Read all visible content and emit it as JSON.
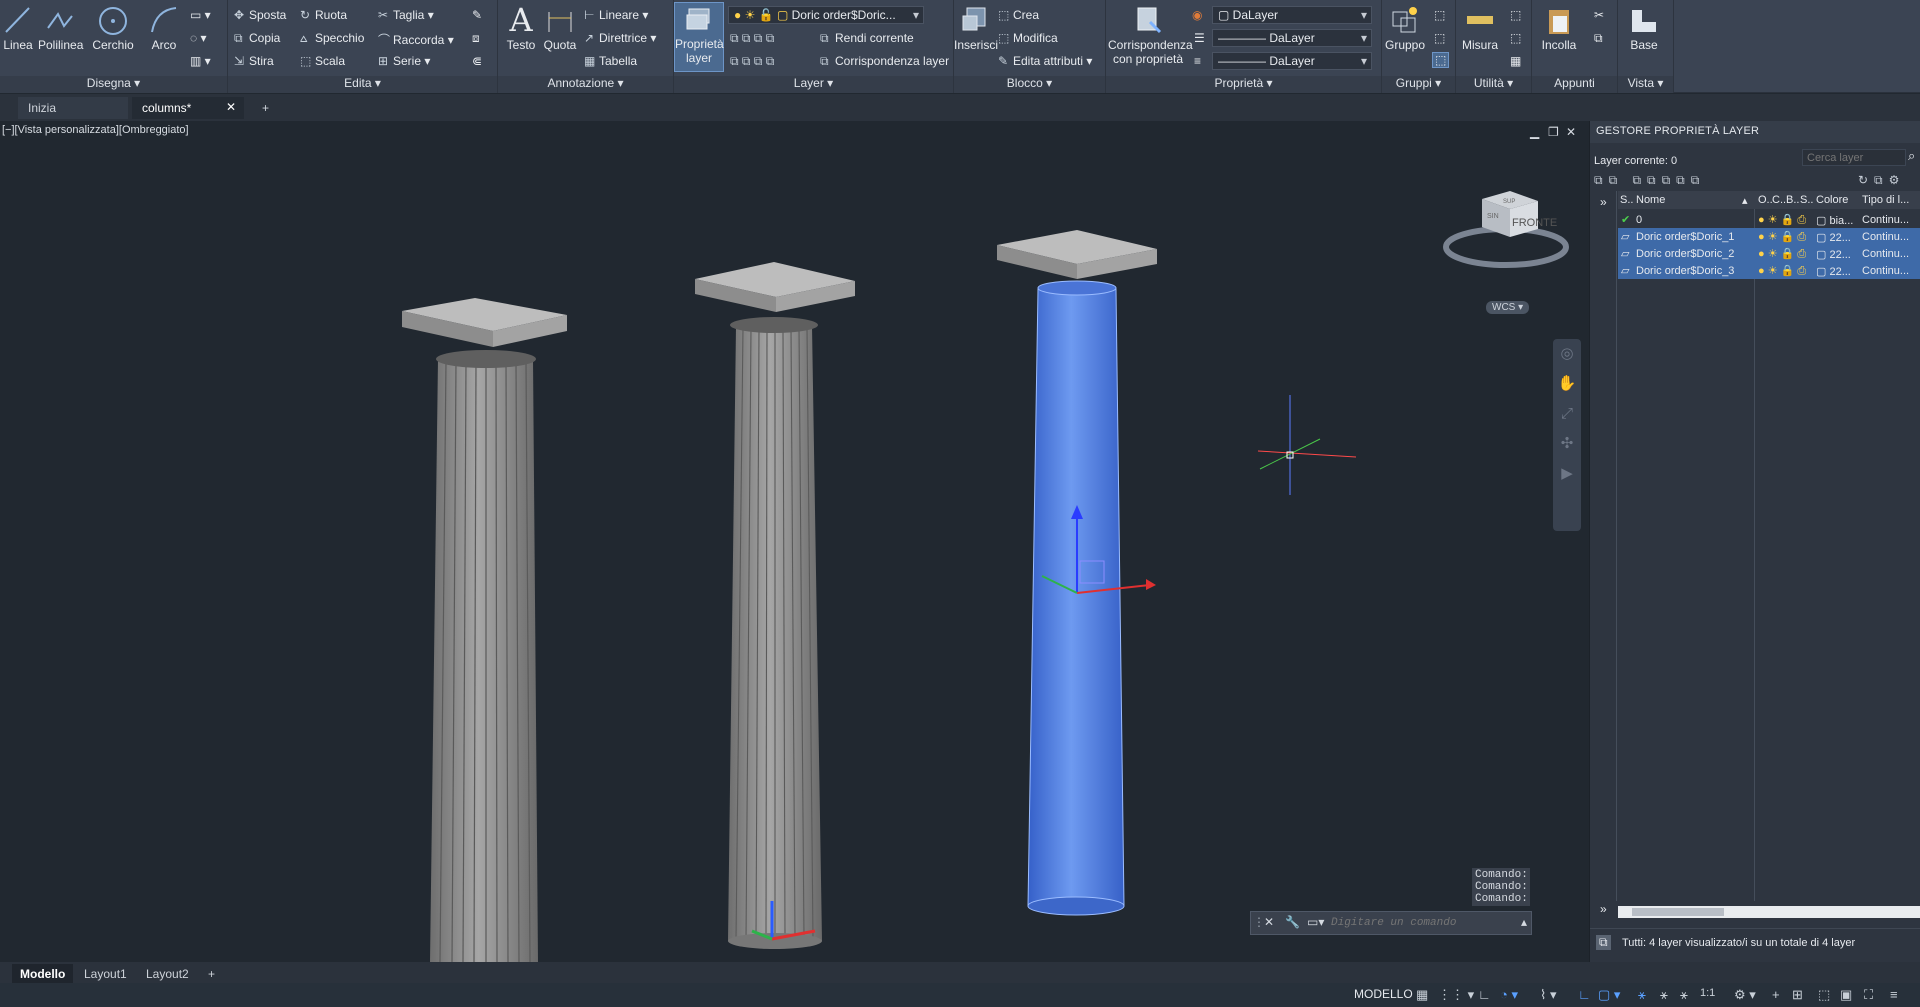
{
  "ribbon": {
    "draw": {
      "linea": "Linea",
      "polilinea": "Polilinea",
      "cerchio": "Cerchio",
      "arco": "Arco",
      "title": "Disegna"
    },
    "modify": {
      "sposta": "Sposta",
      "ruota": "Ruota",
      "taglia": "Taglia",
      "copia": "Copia",
      "specchio": "Specchio",
      "raccorda": "Raccorda",
      "stira": "Stira",
      "scala": "Scala",
      "serie": "Serie",
      "title": "Edita"
    },
    "annotation": {
      "testo": "Testo",
      "quota": "Quota",
      "lineare": "Lineare",
      "direttrice": "Direttrice",
      "tabella": "Tabella",
      "title": "Annotazione"
    },
    "layer": {
      "props_l1": "Proprietà",
      "props_l2": "layer",
      "current_layer": "Doric order$Doric...",
      "rendi": "Rendi corrente",
      "corr": "Corrispondenza layer",
      "title": "Layer"
    },
    "block": {
      "inserisci": "Inserisci",
      "crea": "Crea",
      "modifica": "Modifica",
      "attr": "Edita attributi",
      "title": "Blocco"
    },
    "props": {
      "match_l1": "Corrispondenza",
      "match_l2": "con proprietà",
      "color": "DaLayer",
      "linetype": "DaLayer",
      "lineweight": "DaLayer",
      "title": "Proprietà"
    },
    "groups": {
      "gruppo": "Gruppo",
      "title": "Gruppi"
    },
    "utility": {
      "misura": "Misura",
      "title": "Utilità"
    },
    "clipboard": {
      "incolla": "Incolla",
      "title": "Appunti"
    },
    "view": {
      "base": "Base",
      "title": "Vista"
    }
  },
  "tabs": [
    {
      "label": "Inizia"
    },
    {
      "label": "columns*"
    }
  ],
  "viewport": {
    "label": "[−][Vista personalizzata][Ombreggiato]",
    "viewcube_face": "FRONTE",
    "viewcube_top": "SUP",
    "viewcube_side": "SIN",
    "wcs": "WCS"
  },
  "command": {
    "history": [
      "Comando:",
      "Comando:",
      "Comando:"
    ],
    "placeholder": "Digitare un comando"
  },
  "layer_manager": {
    "title": "GESTORE PROPRIETÀ LAYER",
    "current": "Layer corrente: 0",
    "search": "Cerca layer",
    "headers": {
      "s": "S..",
      "name": "Nome",
      "o": "O..",
      "c": "C..",
      "b": "B..",
      "s2": "S..",
      "color": "Colore",
      "type": "Tipo di l..."
    },
    "rows": [
      {
        "name": "0",
        "color": "bia...",
        "type": "Continu..."
      },
      {
        "name": "Doric order$Doric_1",
        "color": "22...",
        "type": "Continu..."
      },
      {
        "name": "Doric order$Doric_2",
        "color": "22...",
        "type": "Continu..."
      },
      {
        "name": "Doric order$Doric_3",
        "color": "22...",
        "type": "Continu..."
      }
    ],
    "footer": "Tutti: 4 layer visualizzato/i su un totale di 4 layer"
  },
  "layouts": [
    {
      "label": "Modello"
    },
    {
      "label": "Layout1"
    },
    {
      "label": "Layout2"
    }
  ],
  "status": {
    "modello": "MODELLO",
    "scale": "1:1"
  }
}
